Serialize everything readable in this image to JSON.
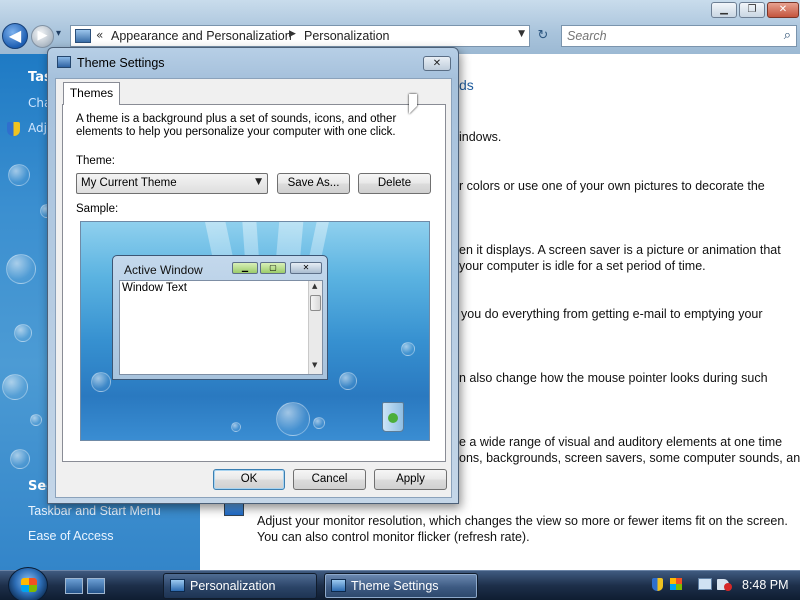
{
  "control_panel": {
    "caption_buttons": {
      "minimize": "▁",
      "maximize": "❐",
      "close": "✕"
    },
    "nav": {
      "back": "◀",
      "forward": "▶",
      "recent": "▾"
    },
    "address": {
      "prefix": "«",
      "crumbs": [
        "Appearance and Personalization",
        "Personalization"
      ],
      "separator": "▶",
      "dropdown": "▼"
    },
    "refresh_glyph": "↻",
    "search": {
      "placeholder": "Search",
      "icon": "⌕"
    },
    "sidebar": {
      "tasks_title": "Tas",
      "tasks": [
        "Cha",
        "Adj"
      ],
      "see_also_title": "See",
      "see_also": [
        "Taskbar and Start Menu",
        "Ease of Access"
      ]
    },
    "content": {
      "heading_fragment": "ds",
      "fragments": [
        "indows.",
        "r colors or use one of your own pictures to decorate the",
        "en it displays. A screen saver is a picture or animation that",
        "your computer is idle for a set period of time.",
        "you do everything from getting e-mail to emptying your",
        "n also change how the mouse pointer looks during such",
        "e a wide range of visual and auditory elements at one time",
        "ons, backgrounds, screen savers, some computer sounds, and",
        "Adjust your monitor resolution, which changes the view so more or fewer items fit on the screen.",
        "You can also control monitor flicker (refresh rate)."
      ]
    }
  },
  "dialog": {
    "title": "Theme Settings",
    "close_glyph": "✕",
    "tab": "Themes",
    "description": "A theme is a background plus a set of sounds, icons, and other\nelements to help you personalize your computer with one click.",
    "theme_label": "Theme:",
    "theme_selected": "My Current Theme",
    "dropdown_arrow": "▼",
    "save_as": "Save As...",
    "delete": "Delete",
    "sample_label": "Sample:",
    "sample": {
      "active_window_title": "Active Window",
      "window_text": "Window Text",
      "caption_min": "▁",
      "caption_max": "▢",
      "caption_close": "✕",
      "scroll_up": "▲",
      "scroll_down": "▼"
    },
    "ok": "OK",
    "cancel": "Cancel",
    "apply": "Apply"
  },
  "taskbar": {
    "tasks": [
      "Personalization",
      "Theme Settings"
    ],
    "active_task": "Theme Settings",
    "clock": "8:48 PM"
  },
  "colors": {
    "sidebar_blue": "#2f86c9",
    "link_blue": "#1e5c9e",
    "taskbar_dark": "#1d2f4a"
  }
}
